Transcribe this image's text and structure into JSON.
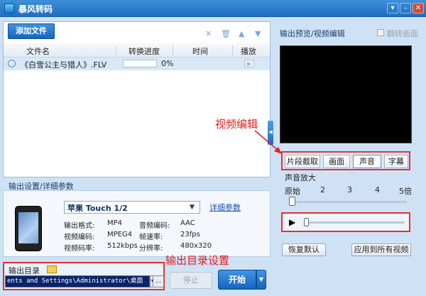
{
  "window": {
    "title": "暴风转码",
    "controls": [
      "▾",
      "–",
      "✕"
    ]
  },
  "toolbar": {
    "add_file": "添加文件"
  },
  "table": {
    "headers": [
      "文件名",
      "转换进度",
      "时间",
      "播放"
    ],
    "rows": [
      {
        "name": "《白雪公主与猎人》.FLV",
        "progress_percent": "0%",
        "time": ""
      }
    ]
  },
  "settings": {
    "title": "输出设置/详细参数",
    "device": "苹果 Touch 1/2",
    "detail_link": "详细参数",
    "params": [
      {
        "label": "输出格式:",
        "value": "MP4"
      },
      {
        "label": "音频编码:",
        "value": "AAC"
      },
      {
        "label": "视频编码:",
        "value": "MPEG4"
      },
      {
        "label": "帧速率:",
        "value": "23fps"
      },
      {
        "label": "视频码率:",
        "value": "512kbps"
      },
      {
        "label": "分辨率:",
        "value": "480x320"
      }
    ]
  },
  "output": {
    "label": "输出目录",
    "path": "ents and Settings\\Administrator\\桌面",
    "browse": "..."
  },
  "actions": {
    "stop": "停止",
    "start": "开始"
  },
  "preview": {
    "title": "输出预览/视频编辑",
    "flip_label": "翻转画面"
  },
  "edit_tabs": [
    "片段截取",
    "画面",
    "声音",
    "字幕"
  ],
  "active_tab": "声音",
  "volume": {
    "title": "声音放大",
    "scale": [
      "原始",
      "2",
      "3",
      "4",
      "5倍"
    ],
    "value": 1
  },
  "buttons": {
    "reset": "恢复默认",
    "apply_all": "应用到所有视频"
  },
  "annotations": {
    "video_edit": "视频编辑",
    "output_dir": "输出目录设置"
  },
  "colors": {
    "accent": "#1d6fc3",
    "annotation": "#e02020"
  }
}
